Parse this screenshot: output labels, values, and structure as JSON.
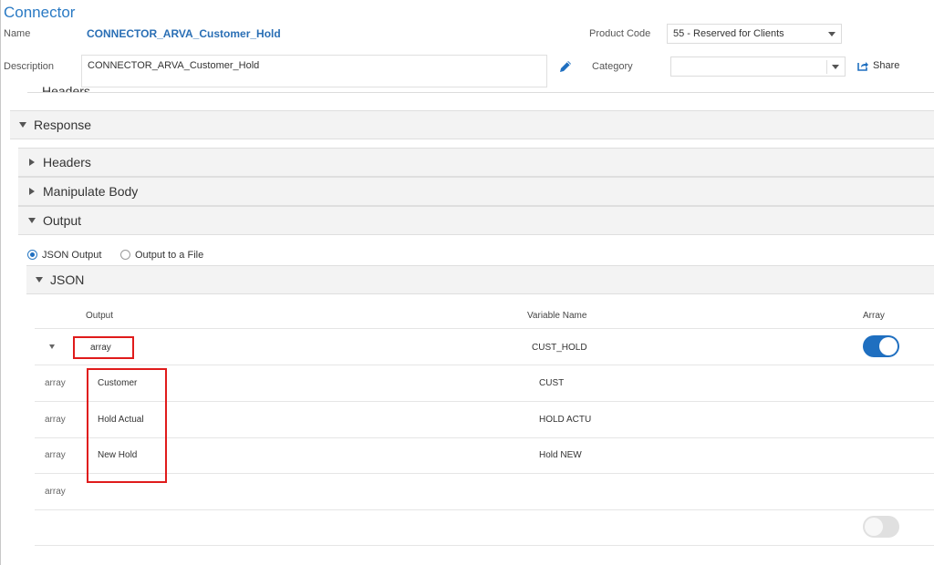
{
  "app": {
    "title": "Connector"
  },
  "form": {
    "name_label": "Name",
    "name_value": "CONNECTOR_ARVA_Customer_Hold",
    "product_code_label": "Product Code",
    "product_code_value": "55 - Reserved for Clients",
    "description_label": "Description",
    "description_value": "CONNECTOR_ARVA_Customer_Hold",
    "category_label": "Category",
    "category_value": "",
    "share_label": "Share"
  },
  "sections": {
    "prev_headers": "Headers",
    "response": "Response",
    "headers": "Headers",
    "manipulate_body": "Manipulate Body",
    "output": "Output",
    "json": "JSON"
  },
  "output_options": {
    "json_output": "JSON Output",
    "output_to_file": "Output to a File",
    "selected": "JSON Output"
  },
  "table": {
    "headers": {
      "output": "Output",
      "variable_name": "Variable Name",
      "array": "Array"
    },
    "root": {
      "output": "array",
      "variable_name": "CUST_HOLD",
      "array": true
    },
    "rows": [
      {
        "type": "array",
        "output": "Customer",
        "variable_name": "CUST"
      },
      {
        "type": "array",
        "output": "Hold Actual",
        "variable_name": "HOLD ACTU"
      },
      {
        "type": "array",
        "output": "New Hold",
        "variable_name": "Hold NEW"
      },
      {
        "type": "array",
        "output": "",
        "variable_name": ""
      }
    ],
    "last_row_array": false
  },
  "colors": {
    "accent": "#1f6fc0",
    "highlight": "#e01b1b",
    "panel": "#f3f3f3"
  }
}
